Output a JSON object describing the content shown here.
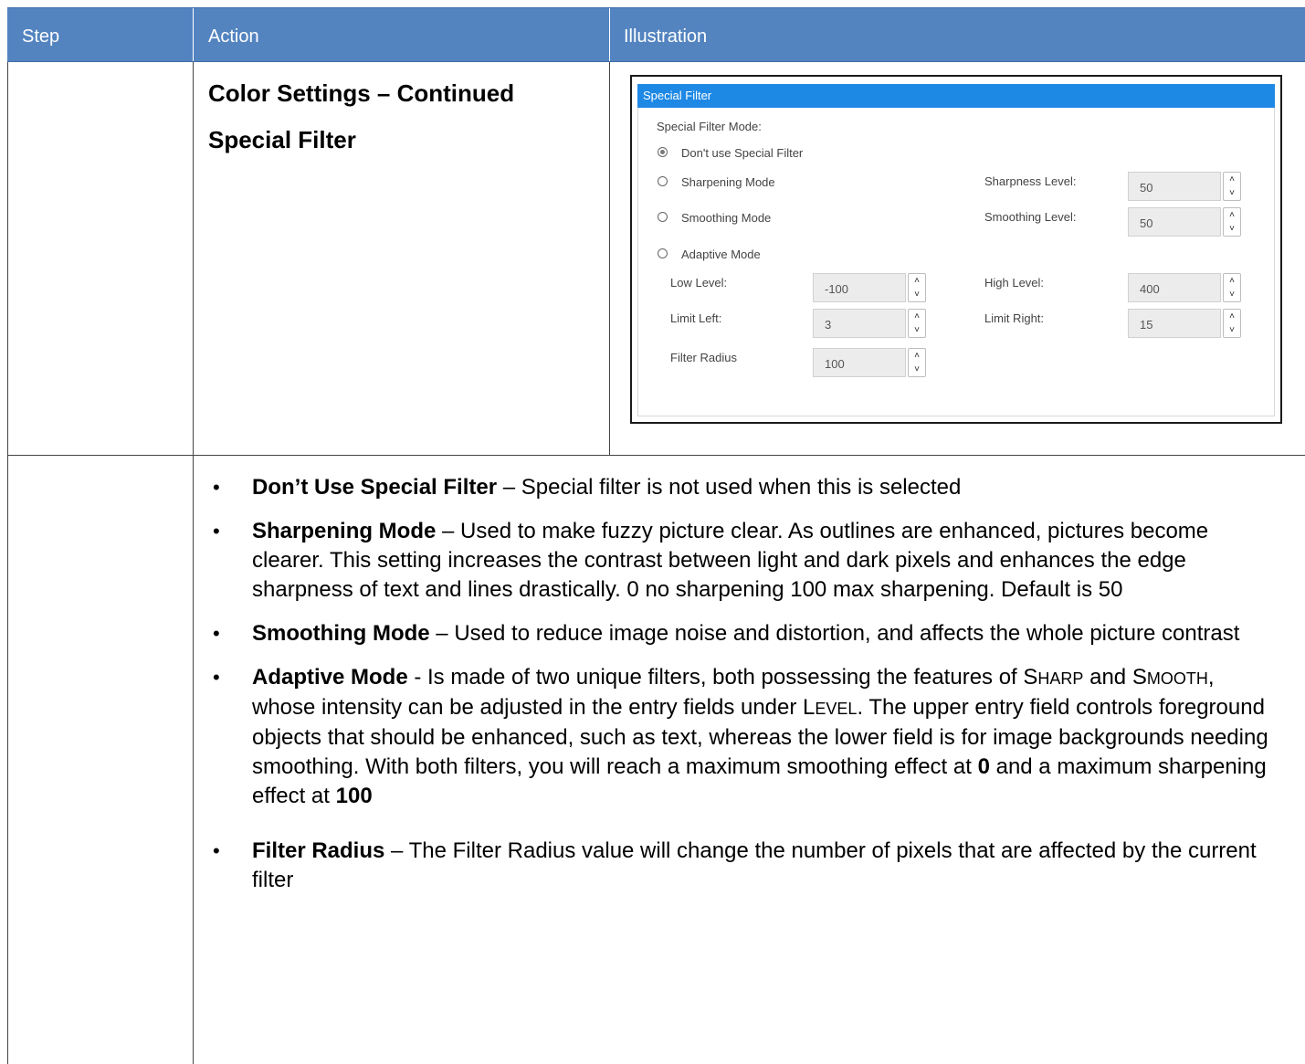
{
  "header": {
    "step": "Step",
    "action": "Action",
    "illustration": "Illustration",
    "background_color": "#5384c0"
  },
  "action": {
    "title_line1": "Color Settings – Continued",
    "title_line2": "Special Filter"
  },
  "panel": {
    "title": "Special Filter",
    "header_color": "#1e88e5",
    "mode_label": "Special Filter Mode:",
    "options": [
      {
        "label": "Don't use Special Filter",
        "checked": true
      },
      {
        "label": "Sharpening Mode",
        "checked": false
      },
      {
        "label": "Smoothing Mode",
        "checked": false
      },
      {
        "label": "Adaptive Mode",
        "checked": false
      }
    ],
    "sharpness_level": {
      "label": "Sharpness Level:",
      "value": "50"
    },
    "smoothing_level": {
      "label": "Smoothing Level:",
      "value": "50"
    },
    "low_level": {
      "label": "Low Level:",
      "value": "-100"
    },
    "high_level": {
      "label": "High Level:",
      "value": "400"
    },
    "limit_left": {
      "label": "Limit Left:",
      "value": "3"
    },
    "limit_right": {
      "label": "Limit Right:",
      "value": "15"
    },
    "filter_radius": {
      "label": "Filter Radius",
      "value": "100"
    },
    "spin_up_icon": "chevron-up-icon",
    "spin_down_icon": "chevron-down-icon"
  },
  "bullets": [
    {
      "term": "Don’t Use Special Filter",
      "text": " – Special filter is not used when this is selected"
    },
    {
      "term": "Sharpening Mode",
      "text": " – Used to make fuzzy picture clear. As outlines are enhanced, pictures become clearer. This setting increases the contrast between light and dark pixels and enhances the edge sharpness of text and lines drastically. 0 no sharpening 100 max sharpening. Default is 50"
    },
    {
      "term": "Smoothing Mode",
      "text": " – Used to reduce image noise and distortion, and affects the whole picture contrast"
    },
    {
      "term": "Adaptive Mode",
      "text_a": " - Is made of two unique filters, both possessing the features of ",
      "sc_sharp_s": "S",
      "sc_sharp_rest": "HARP",
      "text_b": " and ",
      "sc_smooth_s": "S",
      "sc_smooth_rest": "MOOTH",
      "text_c": ", whose intensity can be adjusted in the entry fields under ",
      "sc_level_l": "L",
      "sc_level_rest": "EVEL",
      "text_d": ". The upper entry field controls foreground objects that should be enhanced, such as text, whereas the lower field is for image backgrounds needing smoothing. With both filters, you will reach a maximum smoothing effect at ",
      "bold_zero": "0",
      "text_e": " and a maximum sharpening effect at ",
      "bold_hundred": "100"
    },
    {
      "term": "Filter Radius",
      "text": " – The Filter Radius value will change the number of pixels that are affected by the current filter"
    }
  ]
}
